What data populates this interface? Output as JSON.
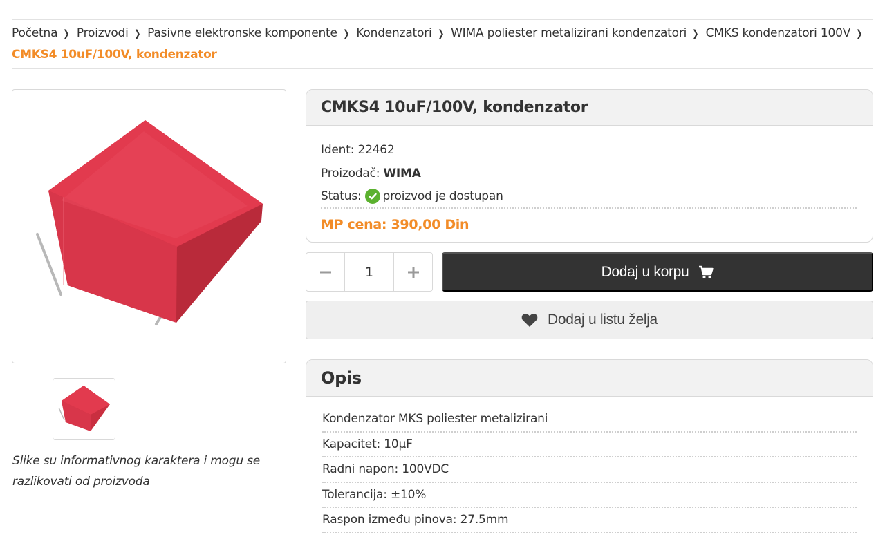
{
  "breadcrumb": {
    "items": [
      "Početna",
      "Proizvodi",
      "Pasivne elektronske komponente",
      "Kondenzatori",
      "WIMA poliester metalizirani kondenzatori",
      "CMKS kondenzatori 100V"
    ],
    "current": "CMKS4 10uF/100V, kondenzator"
  },
  "gallery": {
    "disclaimer": "Slike su informativnog karaktera i mogu se razlikovati od proizvoda"
  },
  "product": {
    "title": "CMKS4 10uF/100V, kondenzator",
    "ident_label": "Ident:",
    "ident_value": "22462",
    "manufacturer_label": "Proizođač:",
    "manufacturer_value": "WIMA",
    "status_label": "Status:",
    "status_icon": "check-circle-icon",
    "status_value": "proizvod je dostupan",
    "price_label": "MP cena:",
    "price_value": "390,00 Din"
  },
  "cart": {
    "quantity": "1",
    "minus_icon": "minus-icon",
    "plus_icon": "plus-icon",
    "add_label": "Dodaj u korpu",
    "cart_icon": "shopping-cart-icon",
    "wishlist_label": "Dodaj u listu želja",
    "wishlist_icon": "heart-icon"
  },
  "description": {
    "title": "Opis",
    "rows": [
      "Kondenzator MKS poliester metalizirani",
      "Kapacitet: 10µF",
      "Radni napon: 100VDC",
      "Tolerancija: ±10%",
      "Raspon između pinova: 27.5mm"
    ]
  },
  "colors": {
    "accent": "#f28c28",
    "button_dark": "#333333",
    "status_green": "#5bb12f",
    "capacitor_red": "#e23a4e"
  }
}
